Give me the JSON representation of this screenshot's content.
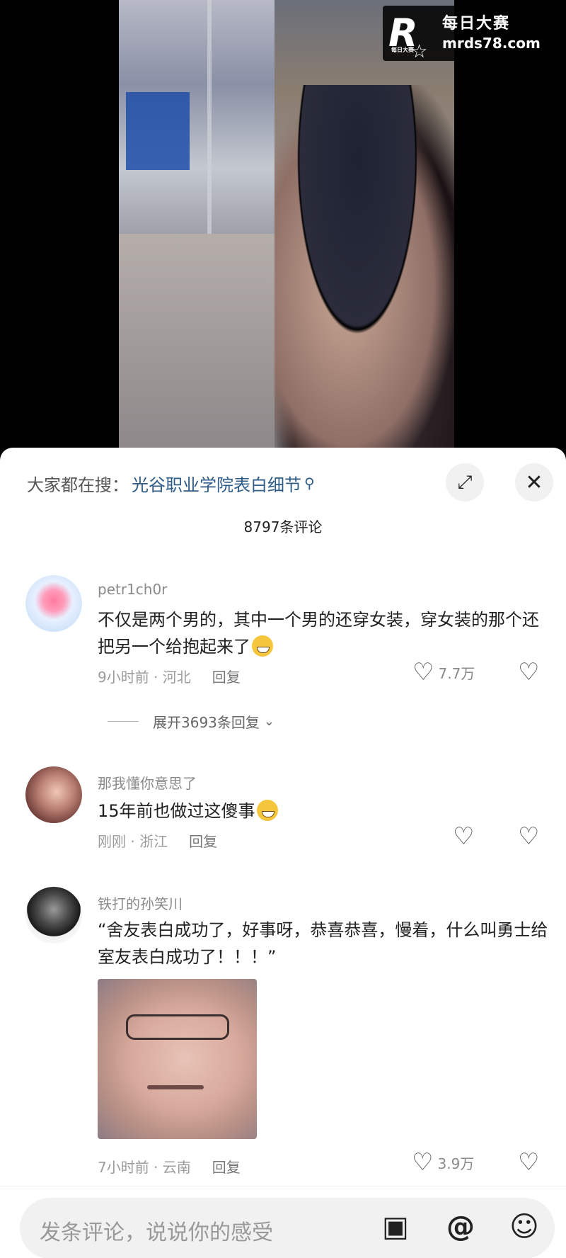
{
  "watermark": {
    "brand_cn": "每日大赛",
    "url": "mrds78.com",
    "logo_letter": "R",
    "logo_sub": "每日大赛"
  },
  "header": {
    "search_prefix": "大家都在搜：",
    "search_term": "光谷职业学院表白细节",
    "comment_count": "8797条评论"
  },
  "comments": [
    {
      "author": "petr1ch0r",
      "text": "不仅是两个男的，其中一个男的还穿女装，穿女装的那个还把另一个给抱起来了",
      "time_location": "9小时前 · 河北",
      "reply_label": "回复",
      "likes": "7.7万",
      "expand_replies": "展开3693条回复"
    },
    {
      "author": "那我懂你意思了",
      "text": "15年前也做过这傻事",
      "time_location": "刚刚 · 浙江",
      "reply_label": "回复"
    },
    {
      "author": "铁打的孙笑川",
      "text": "“舍友表白成功了，好事呀，恭喜恭喜，慢着，什么叫勇士给室友表白成功了！！！”",
      "time_location": "7小时前 · 云南",
      "reply_label": "回复",
      "likes": "3.9万"
    }
  ],
  "input": {
    "placeholder": "发条评论，说说你的感受"
  },
  "icons": {
    "search": "search-icon",
    "expand": "expand-icon",
    "close": "close-icon",
    "like": "heart-icon",
    "dislike": "broken-heart-icon",
    "chevron": "chevron-down-icon",
    "image": "image-icon",
    "mention": "at-icon",
    "emoji": "smiley-icon"
  }
}
